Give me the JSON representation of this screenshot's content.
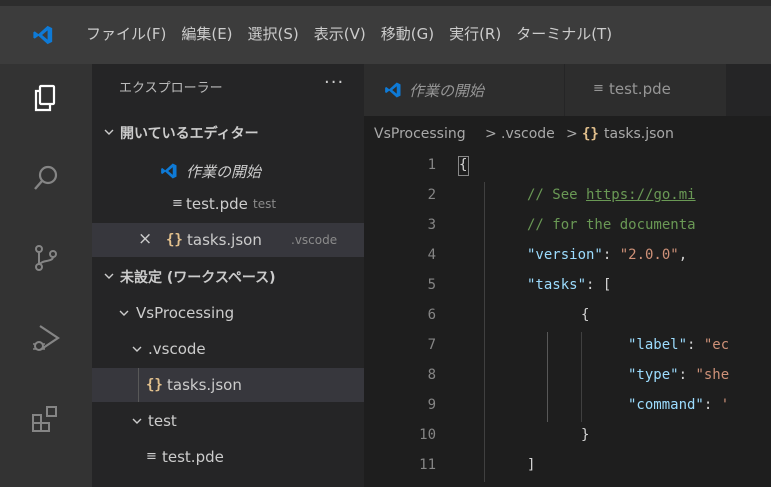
{
  "menu": [
    "ファイル(F)",
    "編集(E)",
    "選択(S)",
    "表示(V)",
    "移動(G)",
    "実行(R)",
    "ターミナル(T)"
  ],
  "sidebar": {
    "title": "エクスプローラー",
    "more": "···",
    "open_editors_header": "開いているエディター",
    "open_editors": [
      {
        "label": "作業の開始"
      },
      {
        "label": "test.pde",
        "hint": "test"
      },
      {
        "label": "tasks.json",
        "hint": ".vscode",
        "close": "×"
      }
    ],
    "workspace_header": "未設定 (ワークスペース)",
    "tree": [
      {
        "label": "VsProcessing"
      },
      {
        "label": ".vscode"
      },
      {
        "label": "tasks.json"
      },
      {
        "label": "test"
      },
      {
        "label": "test.pde"
      }
    ]
  },
  "tabs": [
    {
      "label": "作業の開始"
    },
    {
      "label": "test.pde"
    }
  ],
  "breadcrumb": [
    "VsProcessing",
    ">",
    ".vscode",
    ">",
    "tasks.json"
  ],
  "editor": {
    "line_numbers": [
      "1",
      "2",
      "3",
      "4",
      "5",
      "6",
      "7",
      "8",
      "9",
      "10",
      "11"
    ],
    "lines": {
      "l1": "{",
      "l2_comment": "// See ",
      "l2_link": "https://go.mi",
      "l3": "// for the documenta",
      "l4_key": "\"version\"",
      "l4_colon": ": ",
      "l4_val": "\"2.0.0\"",
      "l4_comma": ",",
      "l5_key": "\"tasks\"",
      "l5_rest": ": [",
      "l6": "{",
      "l7_key": "\"label\"",
      "l7_colon": ": ",
      "l7_val": "\"ec",
      "l8_key": "\"type\"",
      "l8_colon": ": ",
      "l8_val": "\"she",
      "l9_key": "\"command\"",
      "l9_colon": ": ",
      "l9_val": "'",
      "l10": "}",
      "l11": "]"
    }
  },
  "colors": {
    "accent_blue": "#007acc",
    "vscode_logo": "#0e7ad6",
    "json_icon": "#e2c08d"
  },
  "icons": [
    "vscode-logo-icon",
    "explorer-icon",
    "search-icon",
    "source-control-icon",
    "run-debug-icon",
    "extensions-icon",
    "chevron-down-icon",
    "lines-file-icon",
    "json-braces-icon",
    "close-icon"
  ]
}
